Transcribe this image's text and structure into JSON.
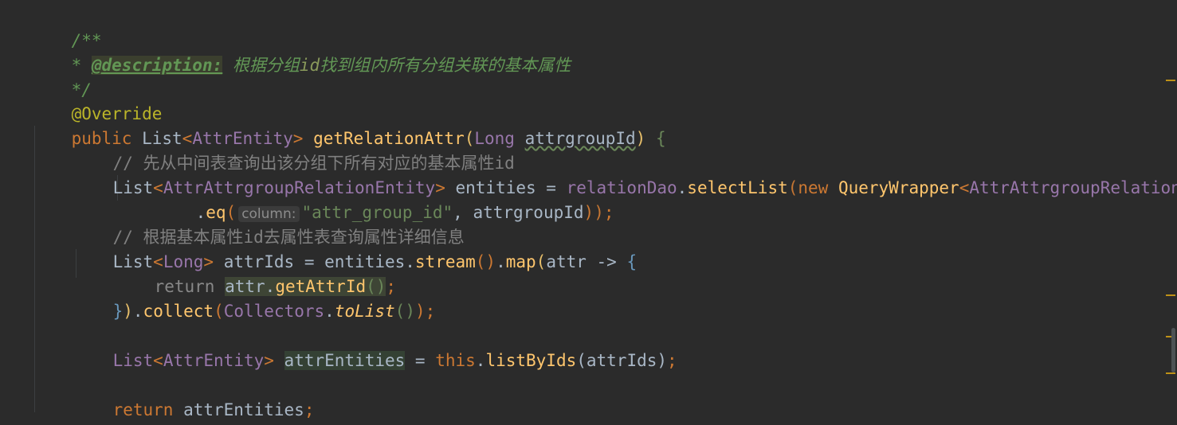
{
  "editor": {
    "lines": {
      "doc_open": "/**",
      "doc_star": "* ",
      "doc_tag": "@description:",
      "doc_text_1": " 根据分组",
      "doc_text_id": "id",
      "doc_text_2": "找到组内所有分组关联的基本属性",
      "doc_close": "*/",
      "annotation": "@Override",
      "sig_public": "public ",
      "sig_list": "List",
      "sig_lt": "<",
      "sig_entity": "AttrEntity",
      "sig_gt": "> ",
      "sig_method": "getRelationAttr",
      "sig_paren_open": "(",
      "sig_long": "Long ",
      "sig_param": "attrgroupId",
      "sig_paren_close": ")",
      "sig_brace": " {",
      "comment_1": "// 先从中间表查询出该分组下所有对应的基本属性id",
      "l6_list": "List",
      "l6_lt": "<",
      "l6_type": "AttrAttrgroupRelationEntity",
      "l6_gt": "> ",
      "l6_var": "entities = ",
      "l6_dao": "relationDao",
      "l6_dot": ".",
      "l6_select": "selectList",
      "l6_paren": "(",
      "l6_new": "new ",
      "l6_qw": "QueryWrapper",
      "l6_lt2": "<",
      "l6_tail": "AttrAttrgroupRelationE",
      "l7_dot": ".",
      "l7_eq": "eq",
      "l7_paren": "(",
      "l7_hint": "column:",
      "l7_str": "\"attr_group_id\"",
      "l7_rest": ", attrgroupId",
      "l7_close1": ")",
      "l7_close2": ")",
      "l7_semi": ";",
      "comment_2": "// 根据基本属性id去属性表查询属性详细信息",
      "l9_list": "List",
      "l9_lt": "<",
      "l9_long": "Long",
      "l9_gt": "> ",
      "l9_var": "attrIds = entities.",
      "l9_stream": "stream",
      "l9_p1": "()",
      "l9_dot": ".",
      "l9_map": "map",
      "l9_p2": "(",
      "l9_lambda": "attr -> ",
      "l9_brace": "{",
      "l10_return": "return ",
      "l10_attr": "attr.",
      "l10_get": "getAttrId",
      "l10_parens": "()",
      "l10_semi": ";",
      "l11_brace": "}",
      "l11_paren": ")",
      "l11_dot": ".",
      "l11_collect": "collect",
      "l11_p1": "(",
      "l11_collectors": "Collectors",
      "l11_dot2": ".",
      "l11_tolist": "toList",
      "l11_p2": "()",
      "l11_p3": ")",
      "l11_semi": ";",
      "l13_list": "List",
      "l13_lt": "<",
      "l13_type": "AttrEntity",
      "l13_gt": "> ",
      "l13_var": "attrEntities",
      "l13_eq": " = ",
      "l13_this": "this",
      "l13_dot": ".",
      "l13_method": "listByIds",
      "l13_args": "(attrIds)",
      "l13_semi": ";",
      "l15_return": "return ",
      "l15_var": "attrEntities",
      "l15_semi": ";",
      "l16_brace": "}"
    }
  },
  "colors": {
    "background": "#2b2b2b",
    "keyword": "#cc7832",
    "method": "#ffc66d",
    "doc_comment": "#629755",
    "line_comment": "#808080",
    "string": "#6a8759",
    "annotation": "#bbb529"
  }
}
